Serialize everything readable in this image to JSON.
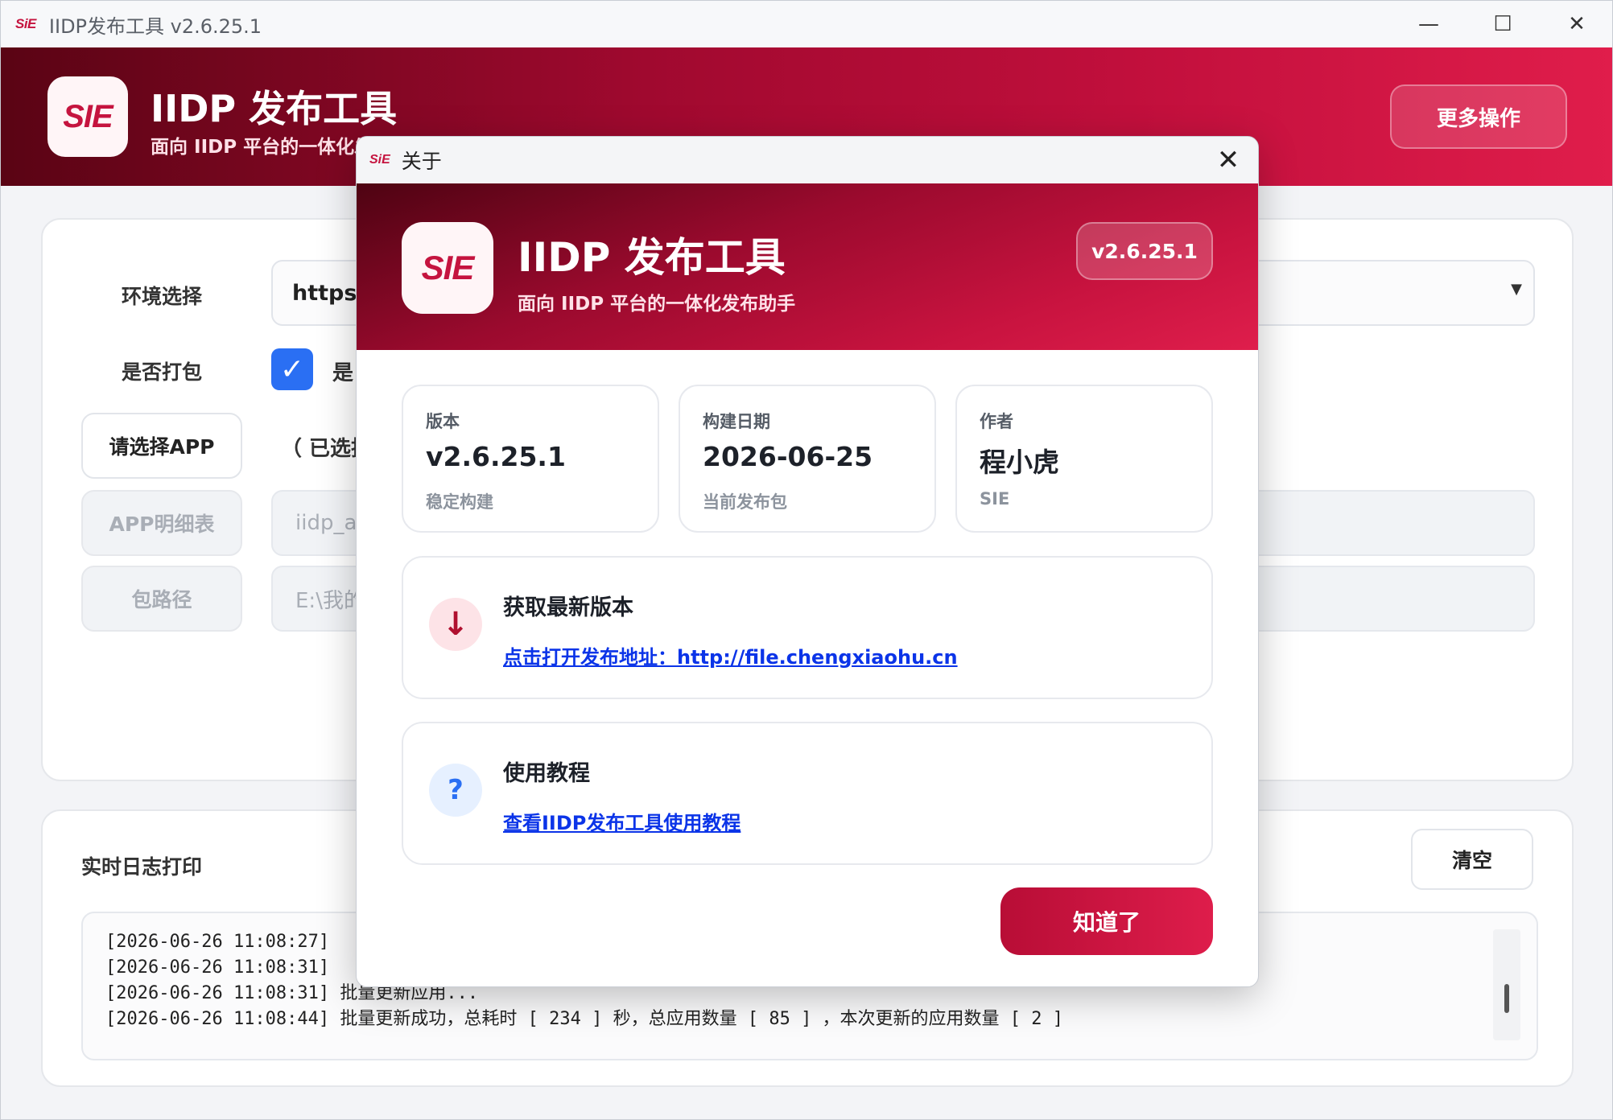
{
  "window": {
    "logo": "SiE",
    "title": "IIDP发布工具 v2.6.25.1",
    "controls": {
      "minimize": "—",
      "maximize": "☐",
      "close": "✕"
    }
  },
  "header": {
    "logo": "SIE",
    "title": "IIDP 发布工具",
    "subtitle": "面向 IIDP 平台的一体化发布助手",
    "more_button": "更多操作"
  },
  "config": {
    "env_label": "环境选择",
    "env_value": "https:/",
    "pack_label": "是否打包",
    "pack_checked": true,
    "pack_checkbox_text": "是",
    "select_app_button": "请选择APP",
    "selected_text": "（ 已选择",
    "app_detail_button": "APP明细表",
    "app_detail_value": "iidp_ap",
    "pkg_path_button": "包路径",
    "pkg_path_value": "E:\\我的"
  },
  "log": {
    "title": "实时日志打印",
    "clear_button": "清空",
    "lines": [
      "[2026-06-26 11:08:27] ",
      "[2026-06-26 11:08:31] ",
      "[2026-06-26 11:08:31] 批量更新应用...",
      "[2026-06-26 11:08:44] 批量更新成功，总耗时 [ 234 ] 秒，总应用数量 [ 85 ] ，本次更新的应用数量 [ 2 ]"
    ]
  },
  "about": {
    "bar_logo": "SiE",
    "bar_title": "关于",
    "logo": "SIE",
    "title": "IIDP 发布工具",
    "subtitle": "面向 IIDP 平台的一体化发布助手",
    "version_pill": "v2.6.25.1",
    "cards": [
      {
        "label": "版本",
        "value": "v2.6.25.1",
        "note": "稳定构建"
      },
      {
        "label": "构建日期",
        "value": "2026-06-25",
        "note": "当前发布包"
      },
      {
        "label": "作者",
        "value": "程小虎",
        "note": "SIE"
      }
    ],
    "download": {
      "icon": "↓",
      "title": "获取最新版本",
      "link": "点击打开发布地址：http://file.chengxiaohu.cn"
    },
    "tutorial": {
      "icon": "?",
      "title": "使用教程",
      "link": "查看IIDP发布工具使用教程"
    },
    "ok_button": "知道了"
  },
  "colors": {
    "brand": "#c5143f",
    "header_dark": "#5a0414",
    "header_light": "#e01d4b",
    "checkbox": "#2a6ff3",
    "link": "#0b34e8"
  }
}
